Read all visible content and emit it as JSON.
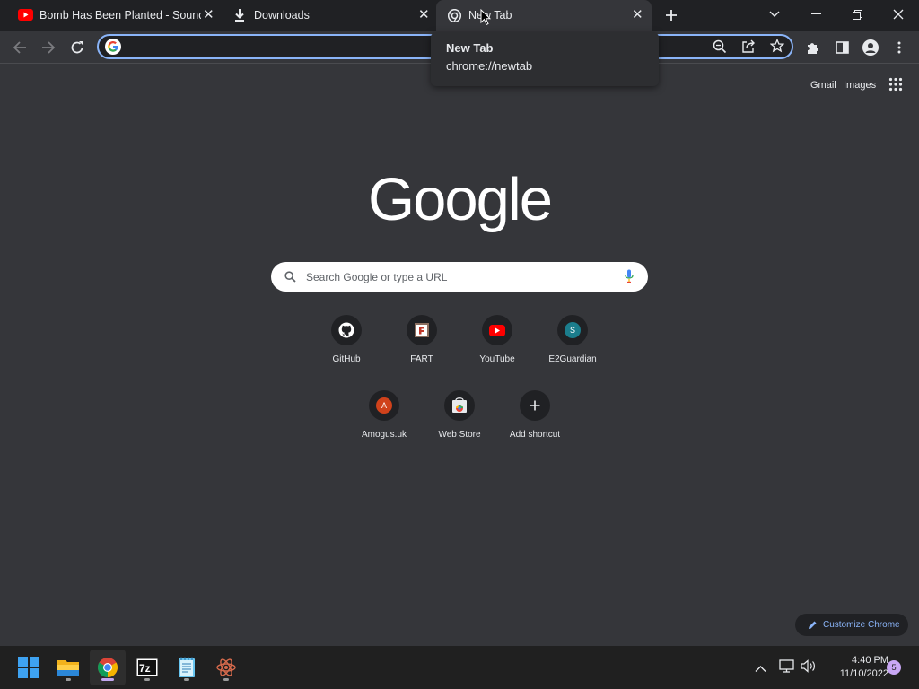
{
  "tabs": [
    {
      "title": "Bomb Has Been Planted - Sound",
      "icon": "youtube-icon"
    },
    {
      "title": "Downloads",
      "icon": "download-icon"
    },
    {
      "title": "New Tab",
      "icon": "chrome-icon"
    }
  ],
  "tooltip": {
    "title": "New Tab",
    "url": "chrome://newtab"
  },
  "omnibox": {
    "value": ""
  },
  "toplinks": {
    "gmail": "Gmail",
    "images": "Images"
  },
  "logo": "Google",
  "search": {
    "placeholder": "Search Google or type a URL"
  },
  "shortcuts": [
    {
      "label": "GitHub",
      "icon": "github-icon"
    },
    {
      "label": "FART",
      "icon": "fart-icon"
    },
    {
      "label": "YouTube",
      "icon": "youtube-icon"
    },
    {
      "label": "E2Guardian",
      "icon": "e2guardian-icon",
      "letter": "S"
    },
    {
      "label": "Amogus.uk",
      "icon": "amogus-icon",
      "letter": "A"
    },
    {
      "label": "Web Store",
      "icon": "webstore-icon"
    },
    {
      "label": "Add shortcut",
      "icon": "plus-icon"
    }
  ],
  "customize": "Customize Chrome",
  "taskbar": {
    "time": "4:40 PM",
    "date": "11/10/2022",
    "notification_count": "5",
    "apps": [
      "start-icon",
      "file-explorer-icon",
      "chrome-icon",
      "7zip-icon",
      "notepad-icon",
      "atom-icon"
    ]
  },
  "colors": {
    "accent": "#8ab4f8",
    "background": "#35363a",
    "tabstrip": "#202124",
    "taskbar": "#202020"
  }
}
